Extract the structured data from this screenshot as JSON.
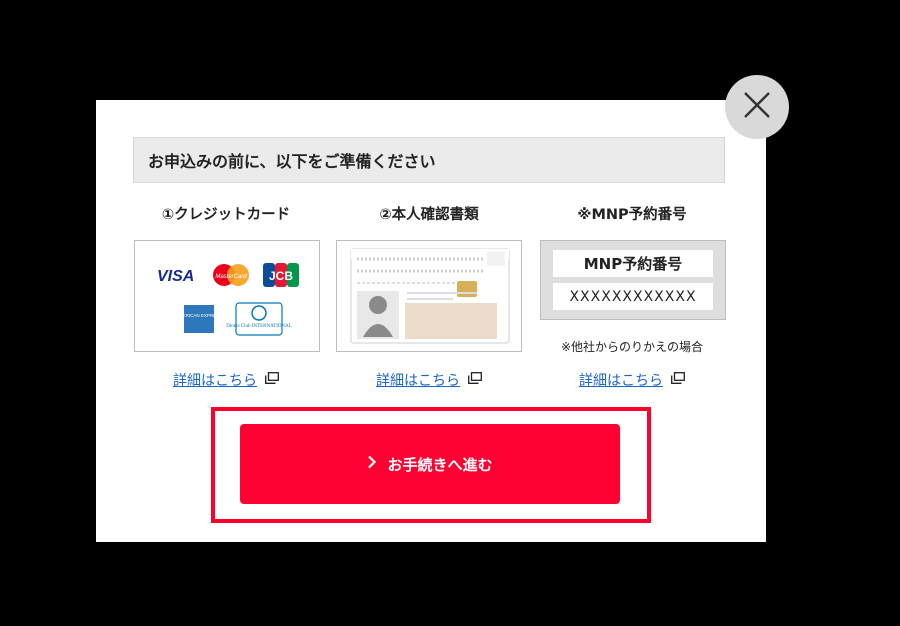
{
  "modal": {
    "close_icon": "close-icon",
    "header": "お申込みの前に、以下をご準備ください",
    "columns": [
      {
        "title": "①クレジットカード",
        "link": "詳細はこちら",
        "link_icon": "external-window-icon",
        "brands": [
          "VISA",
          "MasterCard",
          "JCB",
          "AMERICAN EXPRESS",
          "Diners Club INTERNATIONAL"
        ]
      },
      {
        "title": "②本人確認書類",
        "link": "詳細はこちら",
        "link_icon": "external-window-icon",
        "id_card_image": "id-card-illustration"
      },
      {
        "title": "※MNP予約番号",
        "link": "詳細はこちら",
        "link_icon": "external-window-icon",
        "mnp_label": "MNP予約番号",
        "mnp_value": "XXXXXXXXXXXX",
        "note": "※他社からのりかえの場合"
      }
    ],
    "proceed_button": {
      "label": "お手続きへ進む",
      "icon": "chevron-right-icon"
    },
    "colors": {
      "accent": "#ff0032",
      "link": "#1a66c9",
      "backdrop": "#000000"
    }
  }
}
